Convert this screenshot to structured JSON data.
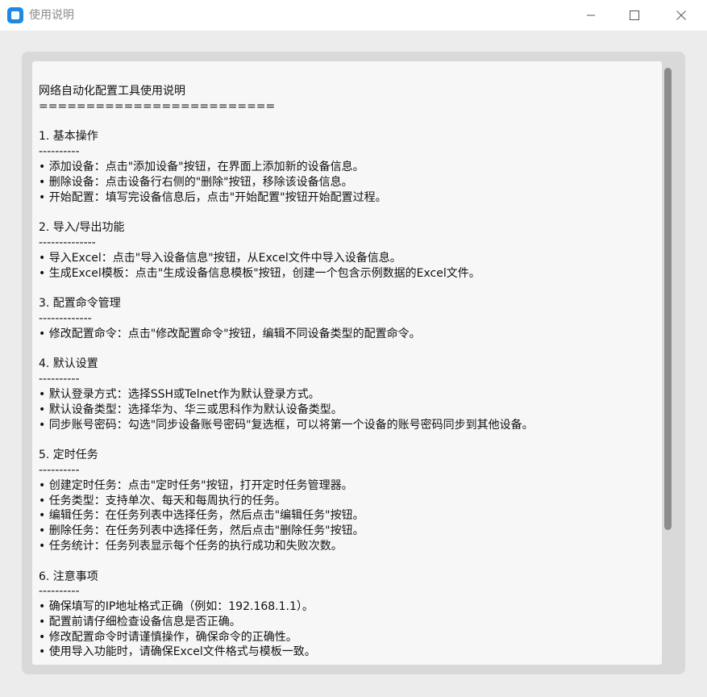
{
  "window": {
    "title": "使用说明",
    "app_icon": "app-icon",
    "controls": [
      "minimize-icon",
      "maximize-icon",
      "close-icon"
    ]
  },
  "help": {
    "lines": [
      "网络自动化配置工具使用说明",
      "=========================",
      "",
      "1. 基本操作",
      "----------",
      "• 添加设备：点击\"添加设备\"按钮，在界面上添加新的设备信息。",
      "• 删除设备：点击设备行右侧的\"删除\"按钮，移除该设备信息。",
      "• 开始配置：填写完设备信息后，点击\"开始配置\"按钮开始配置过程。",
      "",
      "2. 导入/导出功能",
      "--------------",
      "• 导入Excel：点击\"导入设备信息\"按钮，从Excel文件中导入设备信息。",
      "• 生成Excel模板：点击\"生成设备信息模板\"按钮，创建一个包含示例数据的Excel文件。",
      "",
      "3. 配置命令管理",
      "-------------",
      "• 修改配置命令：点击\"修改配置命令\"按钮，编辑不同设备类型的配置命令。",
      "",
      "4. 默认设置",
      "----------",
      "• 默认登录方式：选择SSH或Telnet作为默认登录方式。",
      "• 默认设备类型：选择华为、华三或思科作为默认设备类型。",
      "• 同步账号密码：勾选\"同步设备账号密码\"复选框，可以将第一个设备的账号密码同步到其他设备。",
      "",
      "5. 定时任务",
      "----------",
      "• 创建定时任务：点击\"定时任务\"按钮，打开定时任务管理器。",
      "• 任务类型：支持单次、每天和每周执行的任务。",
      "• 编辑任务：在任务列表中选择任务，然后点击\"编辑任务\"按钮。",
      "• 删除任务：在任务列表中选择任务，然后点击\"删除任务\"按钮。",
      "• 任务统计：任务列表显示每个任务的执行成功和失败次数。",
      "",
      "6. 注意事项",
      "----------",
      "• 确保填写的IP地址格式正确（例如：192.168.1.1）。",
      "• 配置前请仔细检查设备信息是否正确。",
      "• 修改配置命令时请谨慎操作，确保命令的正确性。",
      "• 使用导入功能时，请确保Excel文件格式与模板一致。"
    ]
  }
}
